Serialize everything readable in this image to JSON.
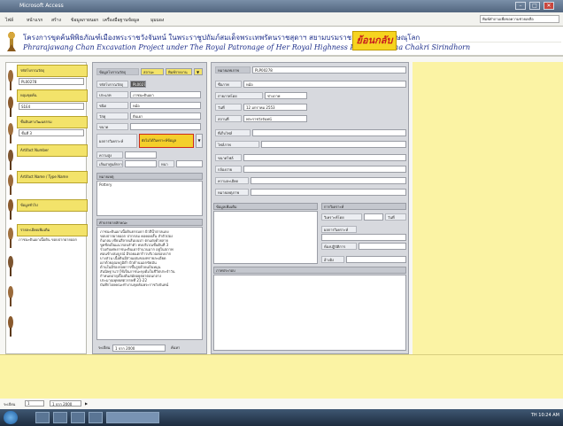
{
  "window": {
    "title": "Microsoft Access",
    "controls": [
      "–",
      "□",
      "✕"
    ]
  },
  "menubar": {
    "items": [
      "ไฟล์",
      "หน้าแรก",
      "สร้าง",
      "ข้อมูลภายนอก",
      "เครื่องมือฐานข้อมูล",
      "มุมมอง"
    ],
    "search": "พิมพ์คำถามเพื่อขอความช่วยเหลือ"
  },
  "banner": {
    "title_th": "โครงการขุดค้นพิพิธภัณฑ์เมืองพระราชวังจันทน์ ในพระราชูปถัมภ์สมเด็จพระเทพรัตนราชสุดาฯ สยามบรมราชกุมารี จังหวัดพิษณุโลก",
    "title_en": "Phrarajawang Chan Excavation Project under The Royal Patronage of Her Royal Highness Princess Maha Chakri Sirindhorn",
    "back_label": "ย้อนกลับ"
  },
  "nav": [
    {
      "label": "รหัสโบราณวัตถุ",
      "value": "PL00278"
    },
    {
      "label": "หลุมขุดค้น",
      "value": "S1E4"
    },
    {
      "label": "ชั้นดินทางวัฒนธรรม",
      "value": "ชั้นที่ 3"
    },
    {
      "label": "Artifact Number",
      "value": ""
    },
    {
      "label": "Artifact Name / Type Name",
      "value": ""
    },
    {
      "label": "ข้อมูลทั่วไป",
      "value": ""
    },
    {
      "label": "รายละเอียดเพิ่มเติม",
      "value": "ภาชนะดินเผาเนื้อดิน ขอบปากผายออก"
    }
  ],
  "form": {
    "head_label": "ข้อมูลโบราณวัตถุ",
    "head_a": "สถานะ",
    "head_b": "พิมพ์รายงาน",
    "rows": [
      {
        "label": "รหัสโบราณวัตถุ",
        "value": "PL00278"
      },
      {
        "label": "ประเภท",
        "value": "ภาชนะดินเผา"
      },
      {
        "label": "ชนิด",
        "value": "หม้อ"
      },
      {
        "label": "วัสดุ",
        "value": "ดินเผา"
      },
      {
        "label": "ขนาด",
        "value": ""
      }
    ],
    "dropdown_label": "ผลการวิเคราะห์",
    "dropdown_value": "ยังไม่ได้วิเคราะห์ข้อมูล",
    "size_rows": [
      {
        "label": "ความสูง",
        "value": ""
      },
      {
        "label": "เส้นผ่าศูนย์กลาง",
        "value": ""
      }
    ],
    "size_extra_label": "หนา",
    "note_label": "หมายเหตุ",
    "note_value": "Pottery",
    "desc_label": "คำบรรยายลักษณะ",
    "desc_text": "ภาชนะดินเผาเนื้อดินธรรมดา ผิวสีน้ำตาลแดง\nขอบปากผายออก ปากกลม คอคอดสั้น ลำตัวป่อง\nก้นกลม เขียนสีลายเส้นบนบ่า ตกแต่งด้วยลาย\nขูดขีดเป็นแนวรอบลำตัว พบบริเวณชั้นดินที่ 3\nร่วมกับเศษภาชนะดินเผาจำนวนมาก อยู่ในสภาพ\nค่อนข้างสมบูรณ์ มีรอยแตกร้าวบริเวณขอบปาก\nบางส่วน เนื้อดินมีส่วนผสมของทรายละเอียด\nเผาด้วยอุณหภูมิต่ำ ผิวด้านนอกขัดมัน\nด้านในมีร่องรอยการขึ้นรูปด้วยแป้นหมุน\nสันนิษฐานว่าใช้เป็นภาชนะหุงต้มในชีวิตประจำวัน\nกำหนดอายุเบื้องต้นสมัยอยุธยาตอนกลาง\nประมาณพุทธศตวรรษที่ 21-22\nบันทึกโดยคณะทำงานขุดค้นพระราชวังจันทน์",
    "footer_label": "ระเบียน",
    "footer_value": "1 จาก 2000",
    "footer_search": "ค้นหา"
  },
  "form2": {
    "head_label": "หมายเลขภาพ",
    "head_value": "PLP00278",
    "rows": [
      {
        "label": "ชื่อภาพ",
        "value": "หม้อ"
      },
      {
        "label": "ถ่ายภาพโดย",
        "value": "ช่างภาพ"
      },
      {
        "label": "วันที่",
        "value": "12 มกราคม 2553"
      },
      {
        "label": "สถานที่",
        "value": "พระราชวังจันทน์"
      },
      {
        "label": "ที่เก็บไฟล์",
        "value": ""
      },
      {
        "label": "ไฟล์ภาพ",
        "value": ""
      },
      {
        "label": "ขนาดไฟล์",
        "value": ""
      },
      {
        "label": "กล้องถ่าย",
        "value": ""
      },
      {
        "label": "ความละเอียด",
        "value": ""
      },
      {
        "label": "หมายเหตุภาพ",
        "value": ""
      }
    ],
    "mid_left_label": "ข้อมูลเพิ่มเติม",
    "mid_right_label": "การวิเคราะห์",
    "mid_right_rows": [
      {
        "label": "วิเคราะห์โดย",
        "value": "",
        "extra": "วันที่"
      },
      {
        "label": "ผลการวิเคราะห์",
        "value": ""
      },
      {
        "label": "ห้องปฏิบัติการ",
        "value": ""
      },
      {
        "label": "อ้างอิง",
        "value": ""
      }
    ],
    "lower_label": "ภาพประกอบ"
  },
  "recnav": {
    "label": "ระเบียน",
    "current": "1",
    "total": "1 จาก 2000"
  },
  "taskbar": {
    "tray": "TH 10:24 AM"
  }
}
